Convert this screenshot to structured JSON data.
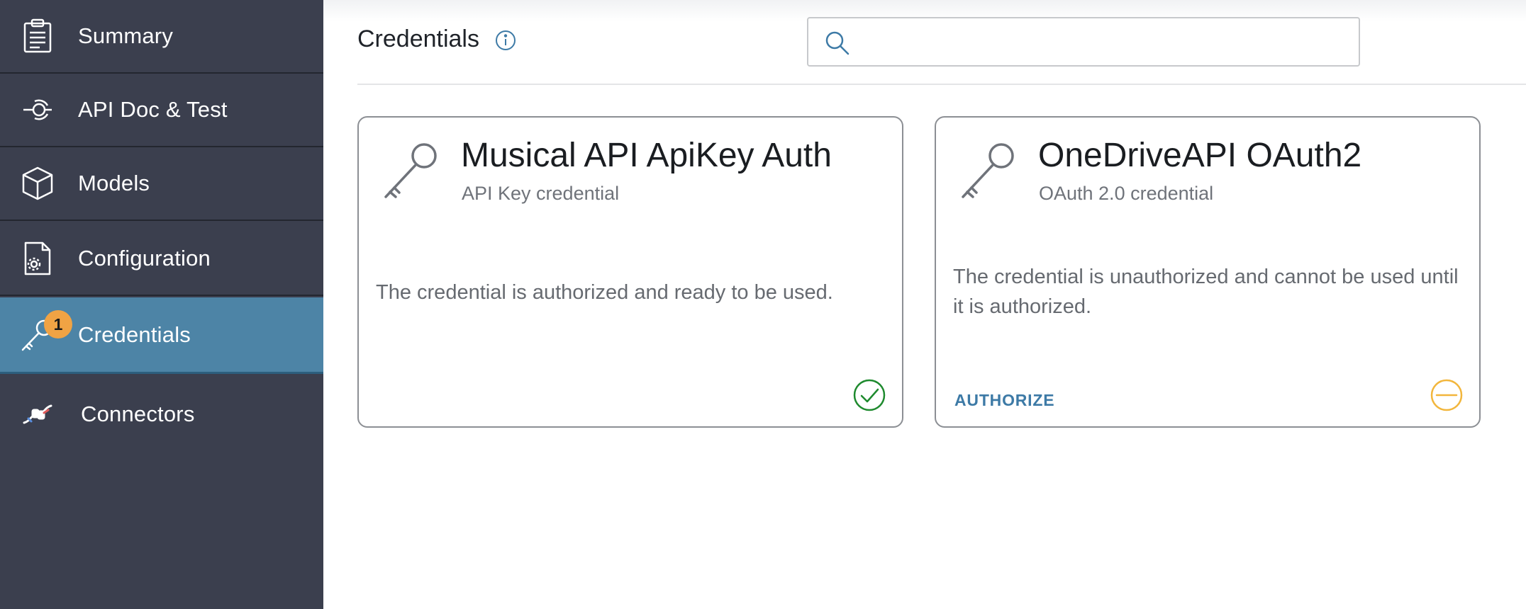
{
  "sidebar": {
    "items": [
      {
        "label": "Summary",
        "icon": "clipboard-icon"
      },
      {
        "label": "API Doc & Test",
        "icon": "api-doc-icon"
      },
      {
        "label": "Models",
        "icon": "cube-icon"
      },
      {
        "label": "Configuration",
        "icon": "config-document-icon"
      },
      {
        "label": "Credentials",
        "icon": "key-icon",
        "active": true,
        "badge": "1"
      },
      {
        "label": "Connectors",
        "icon": "connectors-icon"
      }
    ]
  },
  "header": {
    "title": "Credentials",
    "search_placeholder": ""
  },
  "cards": [
    {
      "title": "Musical API ApiKey Auth",
      "subtitle": "API Key credential",
      "description": "The credential is authorized and ready to be used.",
      "status": "authorized",
      "status_color": "#1e8a2e"
    },
    {
      "title": "OneDriveAPI OAuth2",
      "subtitle": "OAuth 2.0 credential",
      "description": "The credential is unauthorized and cannot be used until it is authorized.",
      "action_label": "AUTHORIZE",
      "status": "unauthorized",
      "status_color": "#f2b63c"
    }
  ],
  "colors": {
    "sidebar_bg": "#3b3f4e",
    "sidebar_active": "#4d84a6",
    "badge": "#f0a344",
    "accent": "#3d7aa6"
  }
}
